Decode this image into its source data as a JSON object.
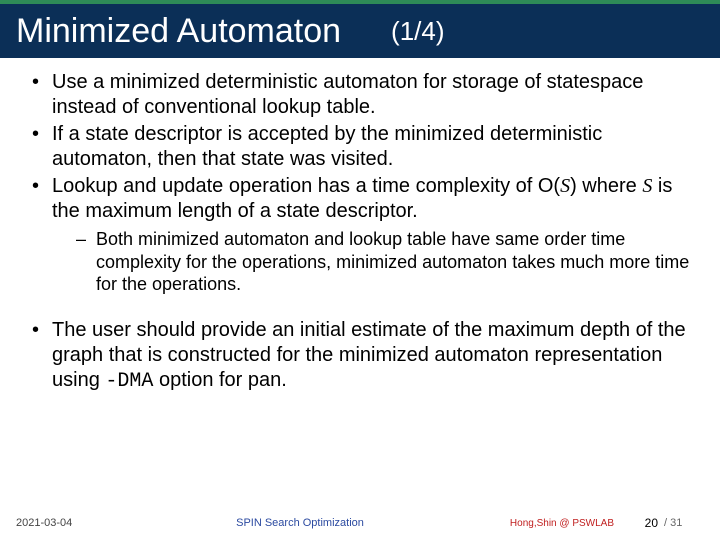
{
  "title": {
    "main": "Minimized Automaton",
    "page_indicator": "(1/4)"
  },
  "bullets": [
    "Use a minimized deterministic automaton for storage of statespace instead of conventional lookup table.",
    "If a state descriptor is accepted by the minimized deterministic automaton, then that state was visited."
  ],
  "bullet3": {
    "prefix": "Lookup and update operation has a time complexity of O(",
    "var": "S",
    "mid": ") where ",
    "var2": "S",
    "suffix": " is the maximum length of a state descriptor."
  },
  "sub1": "Both minimized automaton and lookup table have same order time complexity for the operations, minimized automaton takes much more time for the operations.",
  "bullet4": {
    "prefix": "The user should provide an initial estimate of the maximum depth of the graph that is constructed for the minimized automaton representation using ",
    "code": "-DMA",
    "suffix": " option for pan."
  },
  "footer": {
    "date": "2021-03-04",
    "mid": "SPIN Search Optimization",
    "author": "Hong,Shin @ PSWLAB",
    "page": "20",
    "pages": "/ 31"
  }
}
